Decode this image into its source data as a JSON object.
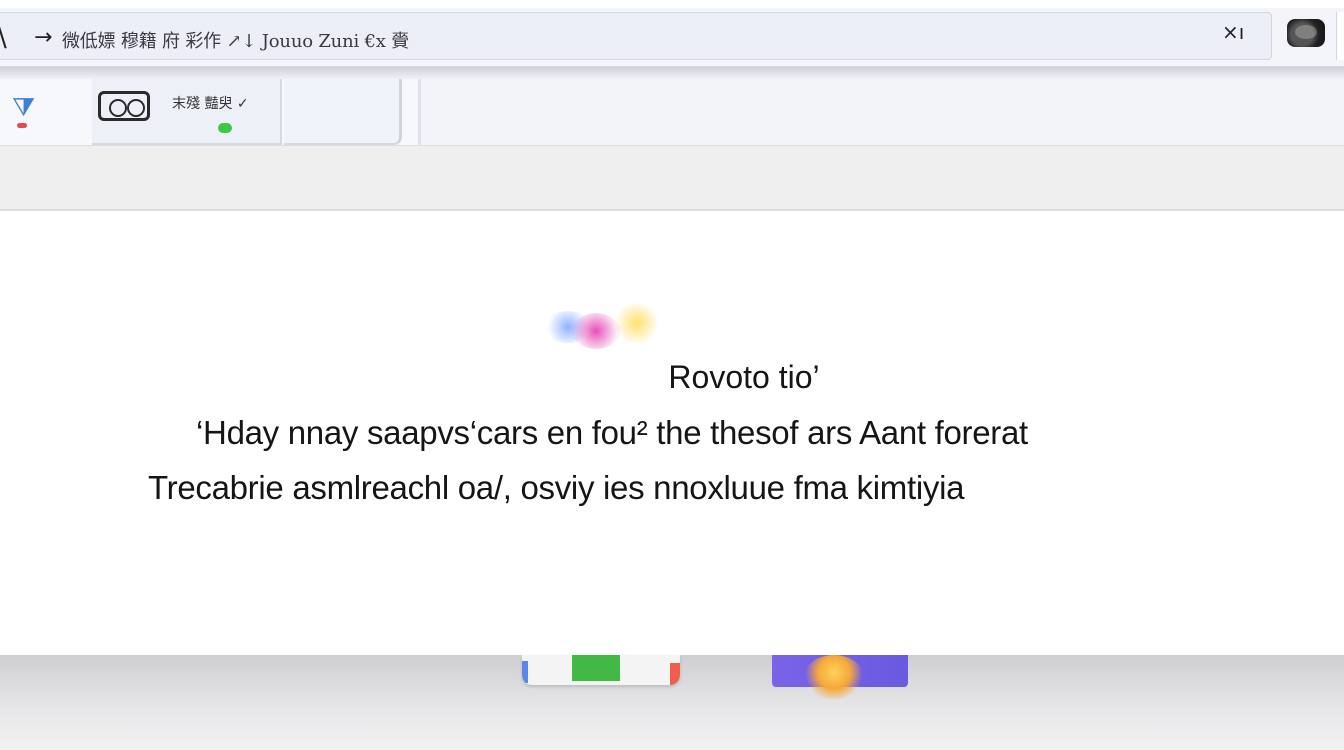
{
  "window": {
    "edge_glyph": "\\",
    "back_glyph": "→",
    "address_text": "微低嫖 穆籍 府 彩作 ↗↓ Jouuo Zuni €x 賫",
    "close_label": "×ı"
  },
  "toolbar": {
    "tab_label": "末殘 豔臾 ✓"
  },
  "dialog": {
    "title": "Rovoto tio’",
    "line1": "‘Hday nnay saapvs‘cars en fou² the thesof ars Aant forerat",
    "line2": "Trecabrie asmlreachl oa/, osviy ies nnoxluue fma kimtiyia"
  },
  "icons": {
    "address": "back-arrow-icon",
    "extension": "extension-icon",
    "filter": "filter-icon",
    "camera": "camera-icon",
    "logo": "app-logo-icon"
  },
  "colors": {
    "accent_blue": "#3f7fd6",
    "status_green": "#3ec64a",
    "alert_red": "#e5484d",
    "tile_purple": "#7a63e8",
    "tile_yellow": "#ffd35a"
  }
}
